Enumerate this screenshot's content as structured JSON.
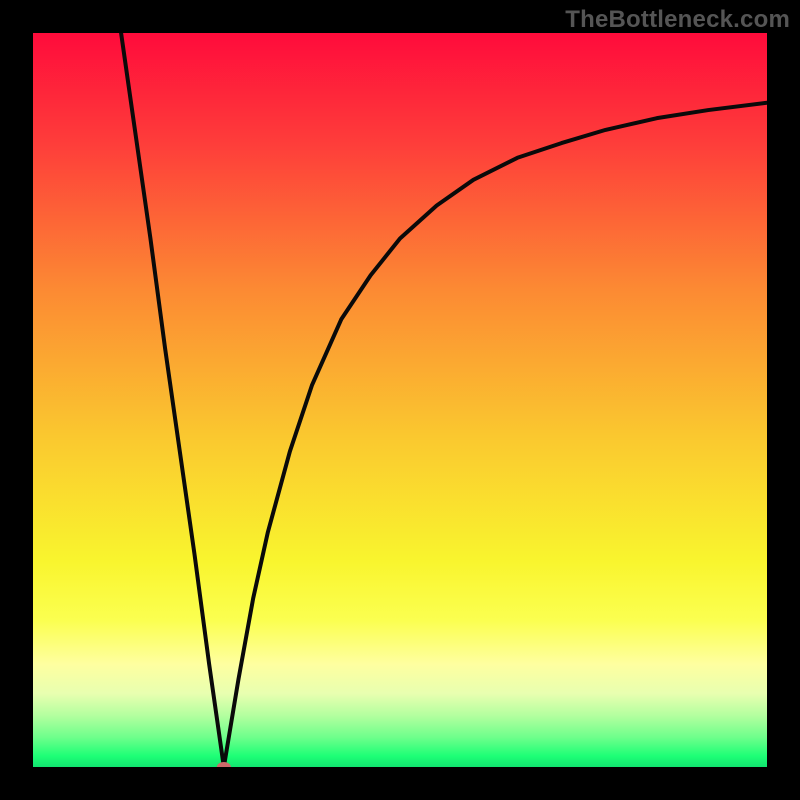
{
  "watermark": "TheBottleneck.com",
  "colors": {
    "frame": "#000000",
    "curve": "#0a0a0a",
    "marker": "#cd6a6a",
    "gradient_stops": [
      {
        "offset": 0.0,
        "color": "#ff0b3b"
      },
      {
        "offset": 0.15,
        "color": "#fe3d3a"
      },
      {
        "offset": 0.35,
        "color": "#fc8a33"
      },
      {
        "offset": 0.55,
        "color": "#fac82f"
      },
      {
        "offset": 0.72,
        "color": "#f9f52e"
      },
      {
        "offset": 0.8,
        "color": "#fbff50"
      },
      {
        "offset": 0.86,
        "color": "#feffa0"
      },
      {
        "offset": 0.9,
        "color": "#e8ffb0"
      },
      {
        "offset": 0.93,
        "color": "#b3ff9f"
      },
      {
        "offset": 0.96,
        "color": "#6dff8b"
      },
      {
        "offset": 0.985,
        "color": "#1eff76"
      },
      {
        "offset": 1.0,
        "color": "#11e470"
      }
    ]
  },
  "chart_data": {
    "type": "line",
    "title": "",
    "xlabel": "",
    "ylabel": "",
    "xlim": [
      0,
      100
    ],
    "ylim": [
      0,
      100
    ],
    "grid": false,
    "legend": false,
    "marker": {
      "x": 26,
      "y": 0,
      "color": "#cd6a6a"
    },
    "series": [
      {
        "name": "curve",
        "x": [
          12,
          14,
          16,
          18,
          20,
          22,
          24,
          25,
          26,
          27,
          28,
          30,
          32,
          35,
          38,
          42,
          46,
          50,
          55,
          60,
          66,
          72,
          78,
          85,
          92,
          100
        ],
        "y": [
          100,
          86,
          72,
          57,
          43,
          29,
          14,
          7,
          0,
          6,
          12,
          23,
          32,
          43,
          52,
          61,
          67,
          72,
          76.5,
          80,
          83,
          85,
          86.8,
          88.4,
          89.5,
          90.5
        ]
      }
    ]
  }
}
